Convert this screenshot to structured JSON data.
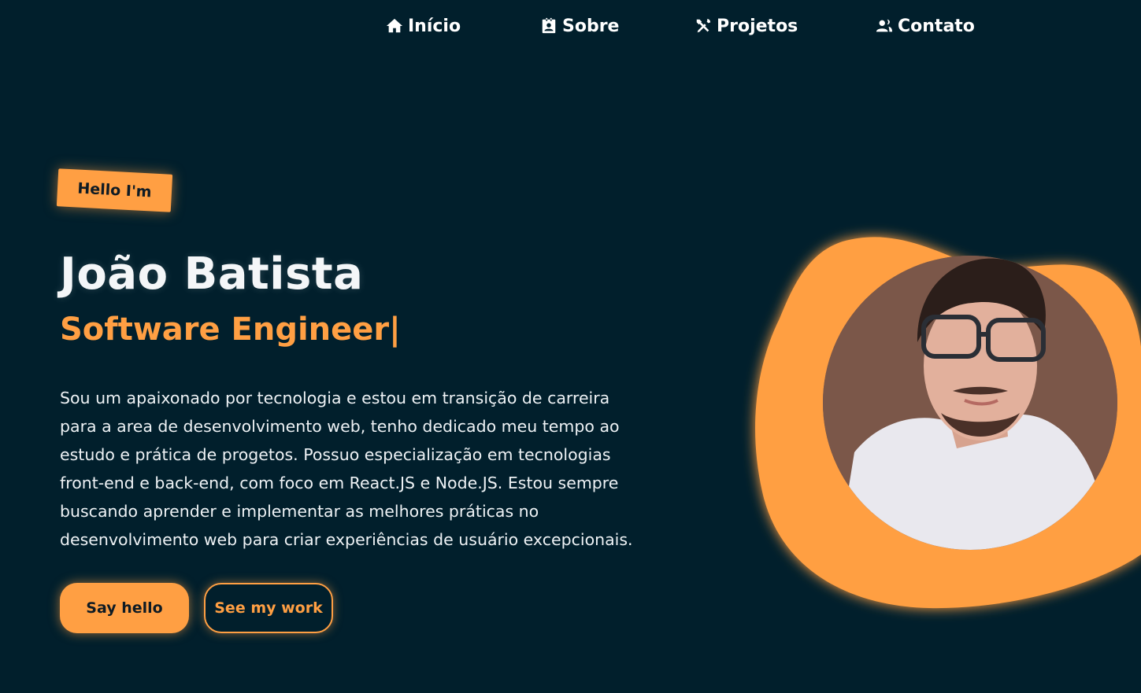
{
  "nav": {
    "items": [
      {
        "label": "Início",
        "icon": "home-icon"
      },
      {
        "label": "Sobre",
        "icon": "id-card-icon"
      },
      {
        "label": "Projetos",
        "icon": "tools-icon"
      },
      {
        "label": "Contato",
        "icon": "users-icon"
      }
    ]
  },
  "hero": {
    "tag": "Hello I'm",
    "name": "João Batista",
    "role": "Software Engineer|",
    "description": "Sou um apaixonado por tecnologia e estou em transição de carreira para a area de desenvolvimento web, tenho dedicado meu tempo ao estudo e prática de progetos. Possuo especialização em tecnologias front-end e back-end, com foco em React.JS e Node.JS. Estou sempre buscando aprender e implementar as melhores práticas no desenvolvimento web para criar experiências de usuário excepcionais.",
    "buttons": {
      "say_hello": "Say hello",
      "see_work": "See my work"
    }
  },
  "colors": {
    "background": "#011f2c",
    "accent": "#ff9f43",
    "text": "#ffffff"
  }
}
